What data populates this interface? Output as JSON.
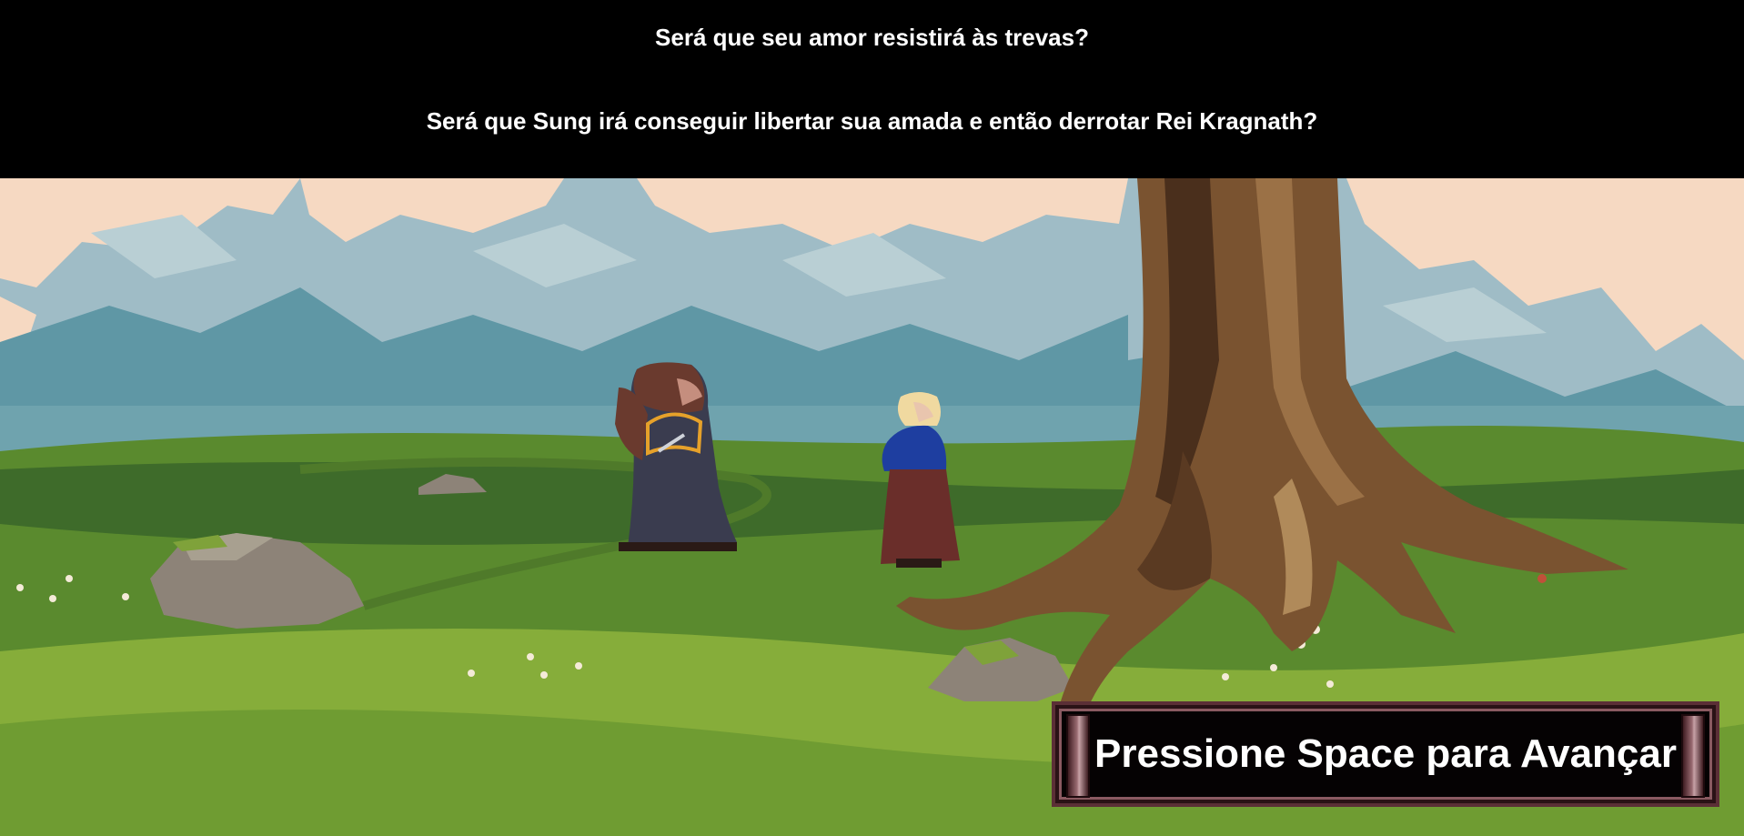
{
  "narration": {
    "line1": "Será que seu amor resistirá às trevas?",
    "line2": "Será que Sung irá conseguir libertar sua amada e então derrotar Rei Kragnath?"
  },
  "prompt": {
    "advance_label": "Pressione Space para Avançar"
  },
  "colors": {
    "sky_cream": "#f6d9c2",
    "sky_blue": "#9fbcc6",
    "sky_teal": "#5f97a5",
    "grass_dark": "#3e6b2a",
    "grass_mid": "#5a8a2e",
    "grass_light": "#86ad3a",
    "tree_trunk": "#7a5330",
    "tree_dark": "#4a2f1c",
    "rock": "#8d8378",
    "hero_robe": "#3a3c4f",
    "hero_hood": "#6a3a2e",
    "maiden_top": "#1e3ea0",
    "maiden_skirt": "#6a2e2a",
    "maiden_hair": "#f0d9a0",
    "prompt_frame": "#5b2f36"
  },
  "icons": {
    "hero": "hooded-warrior-sprite",
    "maiden": "blonde-maiden-sprite",
    "tree": "large-tree-sprite"
  }
}
